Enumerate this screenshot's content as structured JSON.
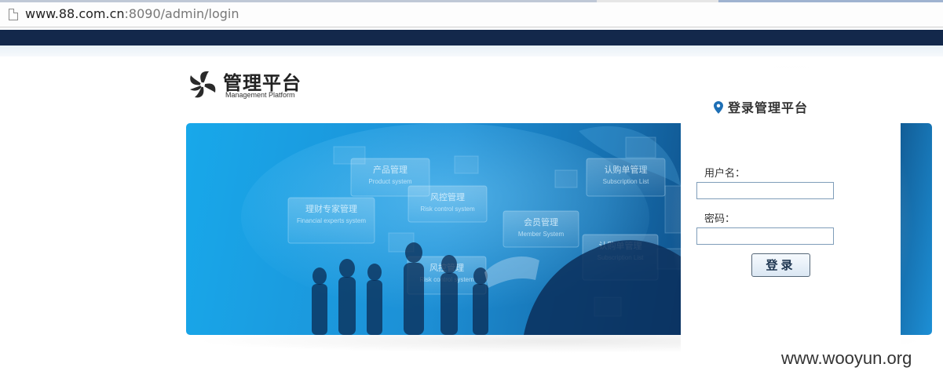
{
  "browser": {
    "url_host": "www.88.com.cn",
    "url_path": ":8090/admin/login",
    "page_icon": "page-icon"
  },
  "logo": {
    "title": "管理平台",
    "subtitle": "Management Platform",
    "icon": "pinwheel-logo-icon"
  },
  "banner": {
    "tiles": [
      {
        "cn": "产品管理",
        "en": "Product system"
      },
      {
        "cn": "风控管理",
        "en": "Risk control system"
      },
      {
        "cn": "理财专家管理",
        "en": "Financial experts system"
      },
      {
        "cn": "会员管理",
        "en": "Member System"
      },
      {
        "cn": "认购单管理",
        "en": "Subscription List"
      },
      {
        "cn": "风控管理",
        "en": "Risk control system"
      },
      {
        "cn": "认购单管理",
        "en": "Subscription List"
      }
    ]
  },
  "login": {
    "heading": "登录管理平台",
    "heading_icon": "map-pin-icon",
    "username_label": "用户名：",
    "username_value": "",
    "password_label": "密码：",
    "password_value": "",
    "submit_label": "登录"
  },
  "watermark": "www.wooyun.org",
  "colors": {
    "nav_strip": "#13284b",
    "banner_light": "#18a8ea",
    "banner_dark": "#0a3a6b",
    "button_text": "#1d3550"
  }
}
